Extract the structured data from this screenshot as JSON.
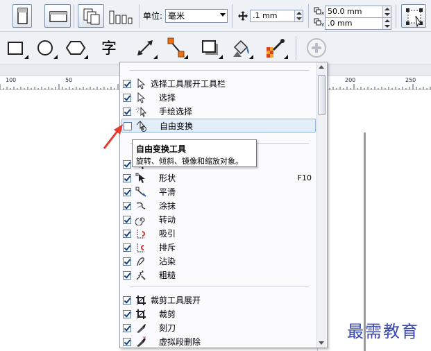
{
  "propbar": {
    "unit_label": "单位:",
    "unit_value": "毫米",
    "nudge_value": ".1 mm",
    "dup_x": "50.0 mm",
    "dup_y": ".0 mm"
  },
  "menu": {
    "rows": [
      {
        "kind": "group",
        "checked": true,
        "icon": "pick-arrow-icon",
        "label": "选择工具展开工具栏",
        "shortcut": ""
      },
      {
        "kind": "item",
        "checked": true,
        "icon": "pick-arrow-icon",
        "label": "选择",
        "shortcut": ""
      },
      {
        "kind": "item",
        "checked": true,
        "icon": "freehand-pick-icon",
        "label": "手绘选择",
        "shortcut": ""
      },
      {
        "kind": "item",
        "checked": false,
        "icon": "free-transform-icon",
        "label": "自由变换",
        "shortcut": "",
        "highlighted": true
      },
      {
        "kind": "item",
        "checked": true,
        "icon": "shape-node-icon",
        "label": "",
        "shortcut": ""
      },
      {
        "kind": "item",
        "checked": true,
        "icon": "shape-node-icon",
        "label": "形状",
        "shortcut": "F10"
      },
      {
        "kind": "item",
        "checked": true,
        "icon": "smooth-icon",
        "label": "平滑",
        "shortcut": ""
      },
      {
        "kind": "item",
        "checked": true,
        "icon": "smear-icon",
        "label": "涂抹",
        "shortcut": ""
      },
      {
        "kind": "item",
        "checked": true,
        "icon": "twirl-icon",
        "label": "转动",
        "shortcut": ""
      },
      {
        "kind": "item",
        "checked": true,
        "icon": "attract-icon",
        "label": "吸引",
        "shortcut": ""
      },
      {
        "kind": "item",
        "checked": true,
        "icon": "repel-icon",
        "label": "排斥",
        "shortcut": ""
      },
      {
        "kind": "item",
        "checked": true,
        "icon": "smudge-icon",
        "label": "沾染",
        "shortcut": ""
      },
      {
        "kind": "item",
        "checked": true,
        "icon": "roughen-icon",
        "label": "粗糙",
        "shortcut": ""
      },
      {
        "kind": "group",
        "checked": true,
        "icon": "crop-icon",
        "label": "裁剪工具展开",
        "shortcut": ""
      },
      {
        "kind": "item",
        "checked": true,
        "icon": "crop-icon",
        "label": "裁剪",
        "shortcut": ""
      },
      {
        "kind": "item",
        "checked": true,
        "icon": "knife-icon",
        "label": "刻刀",
        "shortcut": ""
      },
      {
        "kind": "item",
        "checked": true,
        "icon": "virtual-segment-delete-icon",
        "label": "虚拟段删除",
        "shortcut": ""
      }
    ]
  },
  "tooltip": {
    "title": "自由变换工具",
    "description": "旋转、倾斜、镜像和缩放对象。"
  },
  "ruler": {
    "labels": [
      "100",
      "50",
      "200",
      "250"
    ]
  },
  "watermark": "最需教育",
  "colors": {
    "accent_arrow": "#e23b2e",
    "highlight": "#e3eefb",
    "watermark": "#3a48b5"
  }
}
